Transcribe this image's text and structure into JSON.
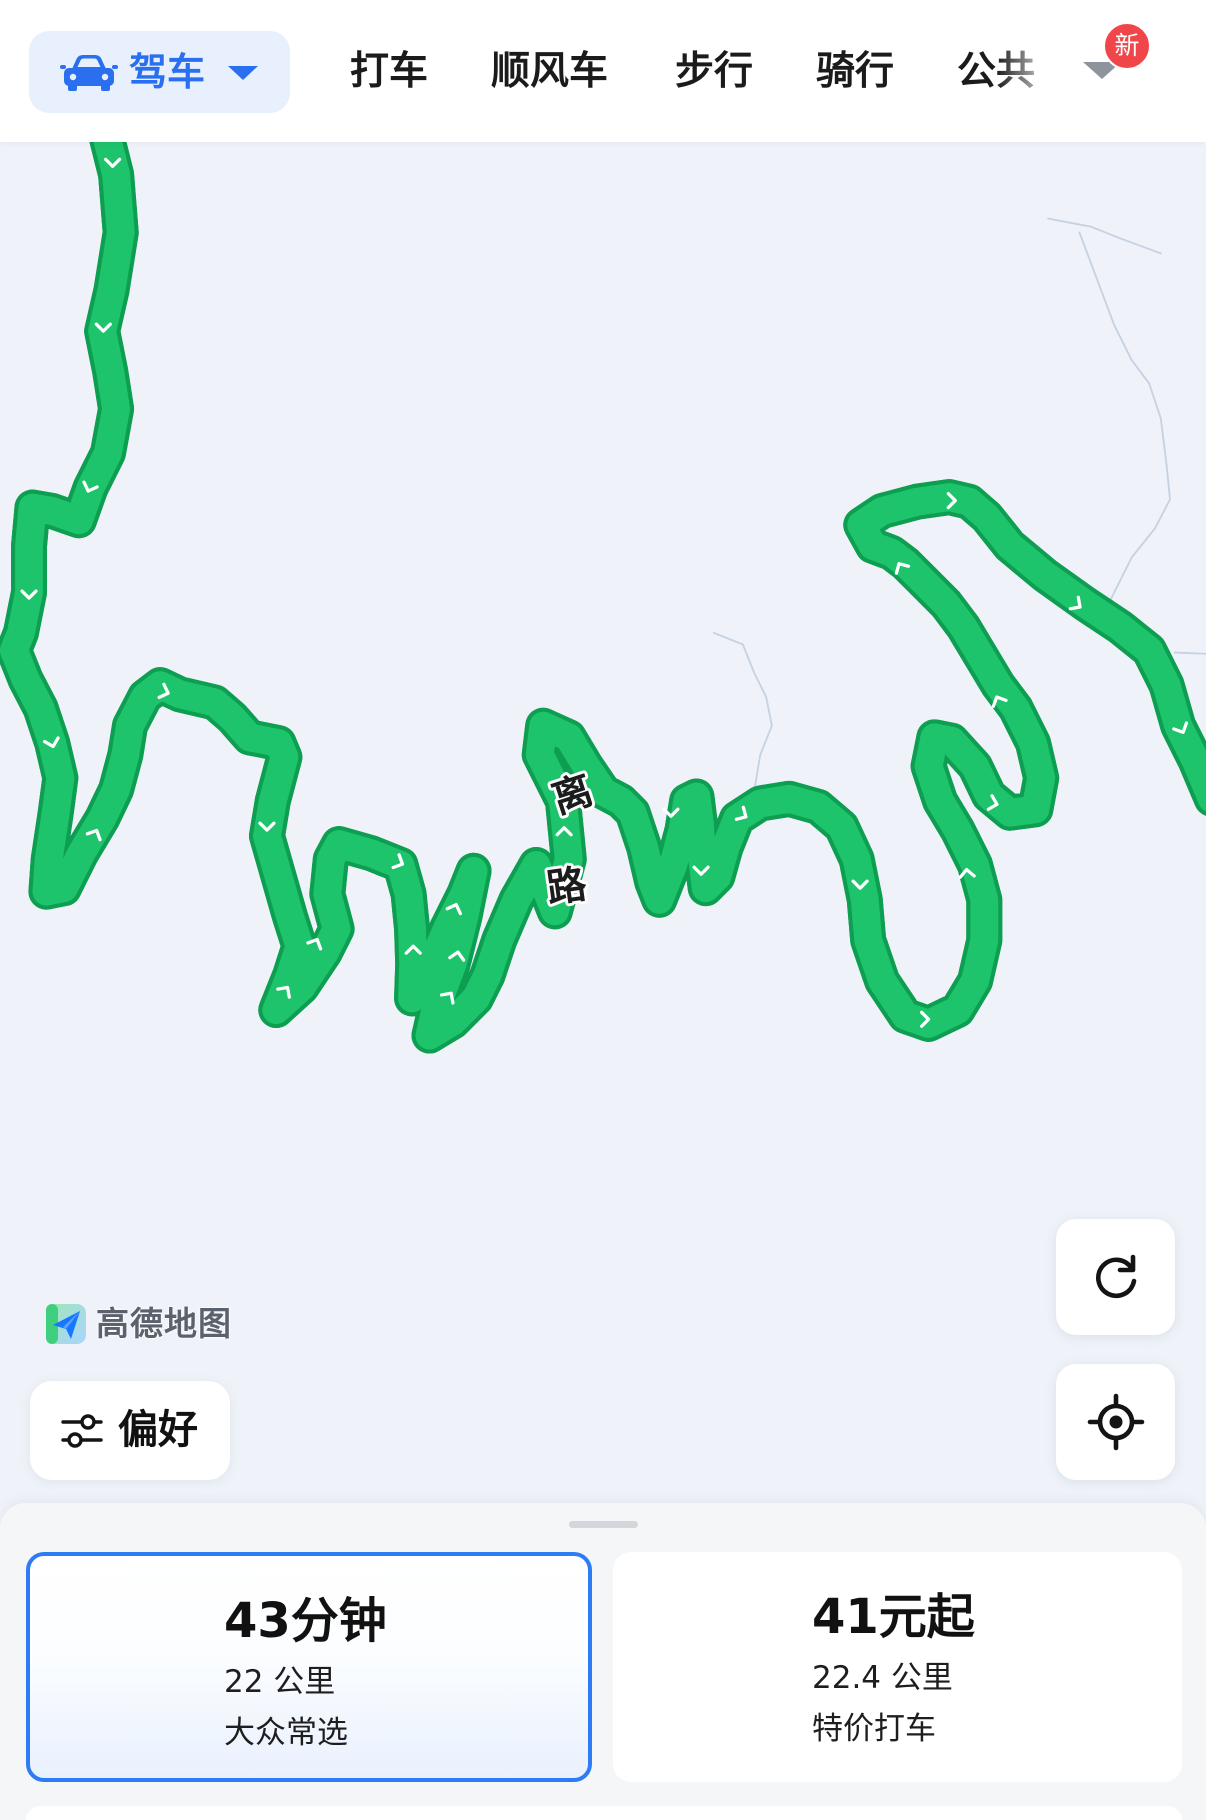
{
  "header": {
    "mode_label": "驾车",
    "mode_icon": "car-icon",
    "tabs": [
      "打车",
      "顺风车",
      "步行",
      "骑行",
      "公共"
    ],
    "more_icon": "chevron-down-icon",
    "new_badge": "新"
  },
  "map": {
    "road_label": [
      "离",
      "路"
    ],
    "logo_text": "高德地图",
    "logo_icon": "amap-logo-icon"
  },
  "controls": {
    "preference_label": "偏好",
    "preference_icon": "sliders-icon",
    "refresh_icon": "refresh-icon",
    "locate_icon": "locate-icon"
  },
  "route_options": [
    {
      "headline": "43分钟",
      "distance": "22 公里",
      "label": "大众常选",
      "selected": true
    },
    {
      "headline": "41元起",
      "distance": "22.4 公里",
      "label": "特价打车",
      "selected": false
    }
  ],
  "colors": {
    "accent": "#2d7cf6",
    "mode_text": "#2a6ff0",
    "badge": "#f0464a",
    "route": "#1ec46c",
    "route_outline": "#0e9e52",
    "map_background": "#eff3f9"
  }
}
